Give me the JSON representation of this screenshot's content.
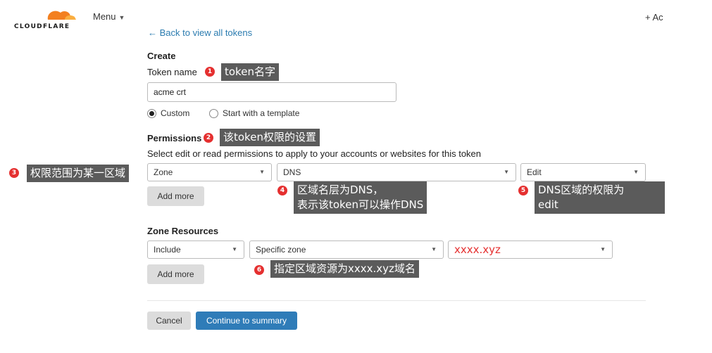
{
  "header": {
    "logo_text": "CLOUDFLARE",
    "menu_label": "Menu",
    "add_label": "+ Ac",
    "brand_color": "#f38020"
  },
  "back_link": "← Back to view all tokens",
  "create": {
    "heading": "Create",
    "token_name_label": "Token name",
    "token_name_value": "acme crt",
    "radio_custom": "Custom",
    "radio_template": "Start with a template",
    "selected": "Custom"
  },
  "permissions": {
    "heading": "Permissions",
    "description": "Select edit or read permissions to apply to your accounts or websites for this token",
    "scope": "Zone",
    "resource": "DNS",
    "access": "Edit",
    "add_more": "Add more"
  },
  "zone_resources": {
    "heading": "Zone Resources",
    "include": "Include",
    "zone_type": "Specific zone",
    "domain": "xxxx.xyz",
    "add_more": "Add more"
  },
  "actions": {
    "cancel": "Cancel",
    "continue": "Continue to summary"
  },
  "annotations": [
    {
      "num": "1",
      "text": "token名字"
    },
    {
      "num": "2",
      "text": "该token权限的设置"
    },
    {
      "num": "3",
      "text": "权限范围为某一区域"
    },
    {
      "num": "4",
      "line1": "区域名层为DNS，",
      "line2": "表示该token可以操作DNS"
    },
    {
      "num": "5",
      "line1": "DNS区域的权限为",
      "line2": "edit"
    },
    {
      "num": "6",
      "text": "指定区域资源为xxxx.xyz域名"
    }
  ],
  "colors": {
    "annotation_bg": "#5b5b5b",
    "badge": "#e53030",
    "primary_button": "#2f7cb8"
  }
}
